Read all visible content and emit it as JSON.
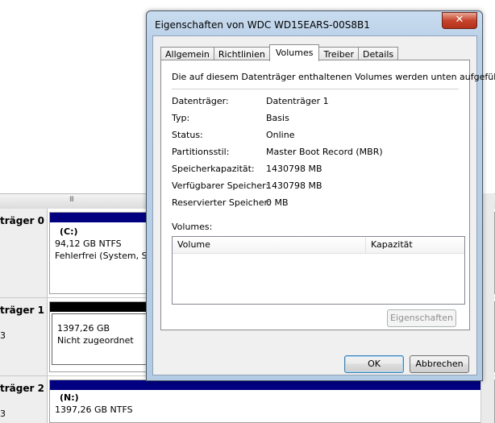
{
  "background": {
    "splitter_grip": "III",
    "disks": [
      {
        "label": "träger 0",
        "sub": "",
        "partition": {
          "name": "(C:)",
          "size": "94,12 GB NTFS",
          "status": "Fehlerfrei (System, Sta"
        }
      },
      {
        "label": "träger 1",
        "sub": "3",
        "partition": {
          "name": "",
          "size": "1397,26 GB",
          "status": "Nicht zugeordnet"
        }
      },
      {
        "label": "träger 2",
        "sub": "3",
        "partition": {
          "name": "(N:)",
          "size": "1397,26 GB NTFS",
          "status": ""
        }
      }
    ],
    "colors": {
      "primary_bar": "#000080",
      "unallocated_bar": "#000000"
    }
  },
  "dialog": {
    "title": "Eigenschaften von WDC WD15EARS-00S8B1",
    "close_glyph": "✕",
    "tabs": [
      "Allgemein",
      "Richtlinien",
      "Volumes",
      "Treiber",
      "Details"
    ],
    "active_tab": "Volumes",
    "intro": "Die auf diesem Datenträger enthaltenen Volumes werden unten aufgeführt.",
    "properties": [
      {
        "label": "Datenträger:",
        "value": "Datenträger 1"
      },
      {
        "label": "Typ:",
        "value": "Basis"
      },
      {
        "label": "Status:",
        "value": "Online"
      },
      {
        "label": "Partitionsstil:",
        "value": "Master Boot Record (MBR)"
      },
      {
        "label": "Speicherkapazität:",
        "value": "1430798 MB"
      },
      {
        "label": "Verfügbarer Speicher:",
        "value": "1430798 MB"
      },
      {
        "label": "Reservierter Speicher:",
        "value": "0 MB"
      }
    ],
    "volumes_label": "Volumes:",
    "volumes_columns": [
      "Volume",
      "Kapazität"
    ],
    "volumes_rows": [],
    "properties_button": "Eigenschaften",
    "ok_button": "OK",
    "cancel_button": "Abbrechen"
  }
}
